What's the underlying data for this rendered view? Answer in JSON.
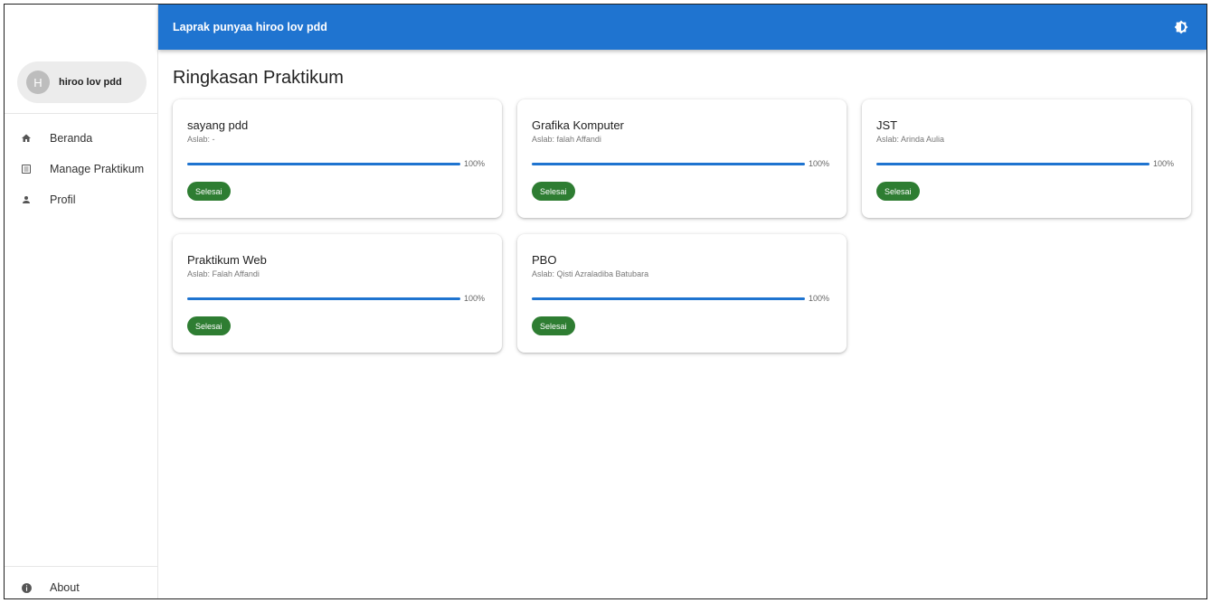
{
  "app": {
    "title": "Laprak punyaa hiroo lov pdd"
  },
  "user": {
    "initial": "H",
    "name": "hiroo lov pdd"
  },
  "nav": {
    "items": [
      {
        "label": "Beranda",
        "icon": "home-icon"
      },
      {
        "label": "Manage Praktikum",
        "icon": "list-icon"
      },
      {
        "label": "Profil",
        "icon": "person-icon"
      }
    ],
    "about": {
      "label": "About",
      "icon": "info-icon"
    }
  },
  "page": {
    "title": "Ringkasan Praktikum"
  },
  "colors": {
    "primary": "#1f74d0",
    "success": "#2e7d32"
  },
  "cards": [
    {
      "title": "sayang pdd",
      "aslab": "Aslab: -",
      "progress": 100,
      "progress_text": "100%",
      "status": "Selesai"
    },
    {
      "title": "Grafika Komputer",
      "aslab": "Aslab: falah Affandi",
      "progress": 100,
      "progress_text": "100%",
      "status": "Selesai"
    },
    {
      "title": "JST",
      "aslab": "Aslab: Arinda Aulia",
      "progress": 100,
      "progress_text": "100%",
      "status": "Selesai"
    },
    {
      "title": "Praktikum Web",
      "aslab": "Aslab: Falah Affandi",
      "progress": 100,
      "progress_text": "100%",
      "status": "Selesai"
    },
    {
      "title": "PBO",
      "aslab": "Aslab: Qisti Azraladiba Batubara",
      "progress": 100,
      "progress_text": "100%",
      "status": "Selesai"
    }
  ]
}
